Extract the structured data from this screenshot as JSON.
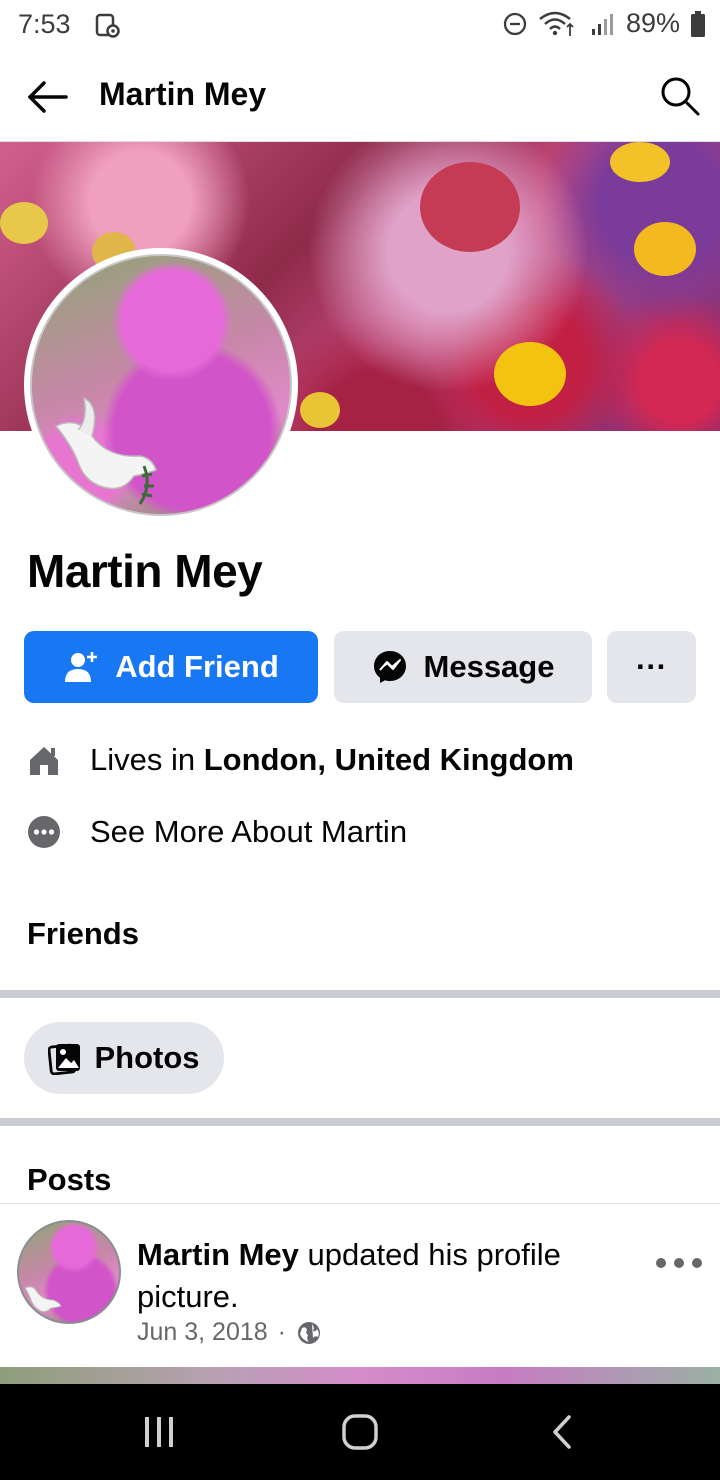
{
  "status_bar": {
    "time": "7:53",
    "battery": "89%",
    "icons": [
      "screen-record-icon",
      "do-not-disturb-icon",
      "wifi-icon",
      "signal-icon",
      "battery-icon"
    ]
  },
  "app_bar": {
    "title": "Martin Mey",
    "back_icon": "arrow-left-icon",
    "search_icon": "search-icon"
  },
  "profile": {
    "name": "Martin Mey",
    "add_friend_label": "Add Friend",
    "message_label": "Message",
    "more_label": "···"
  },
  "info": {
    "lives_in_prefix": "Lives in",
    "lives_in_place": "London, United Kingdom",
    "see_more": "See More About Martin"
  },
  "sections": {
    "friends": "Friends",
    "photos": "Photos",
    "posts": "Posts"
  },
  "post": {
    "author": "Martin Mey",
    "text": "updated his profile picture.",
    "date": "Jun 3, 2018",
    "separator": "·",
    "audience_icon": "globe-icon"
  },
  "colors": {
    "primary": "#1877f2",
    "button_gray": "#e4e6eb",
    "text": "#050505",
    "secondary_text": "#65676b"
  }
}
